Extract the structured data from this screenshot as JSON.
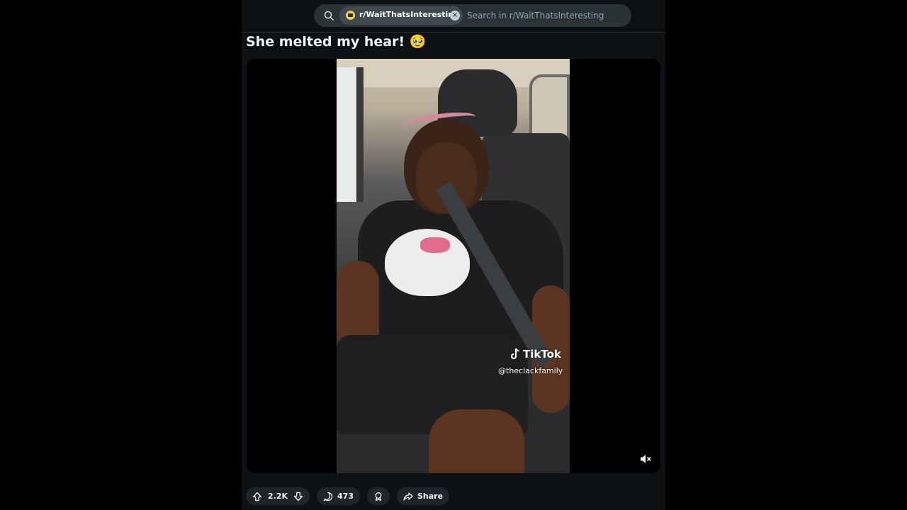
{
  "search": {
    "community": "r/WaitThatsInteresting",
    "placeholder": "Search in r/WaitThatsInteresting"
  },
  "post": {
    "title": "She melted my hear! 🥹"
  },
  "video": {
    "watermark_brand": "TikTok",
    "watermark_handle": "@theclackfamily",
    "muted": true
  },
  "actions": {
    "votes": "2.2K",
    "comments": "473",
    "share_label": "Share"
  },
  "colors": {
    "background": "#000000",
    "column": "#0e1113",
    "search_bg": "#2a3236",
    "pill_bg": "#1f2529",
    "text": "#f2f4f5",
    "muted_text": "#8ba2ad"
  }
}
